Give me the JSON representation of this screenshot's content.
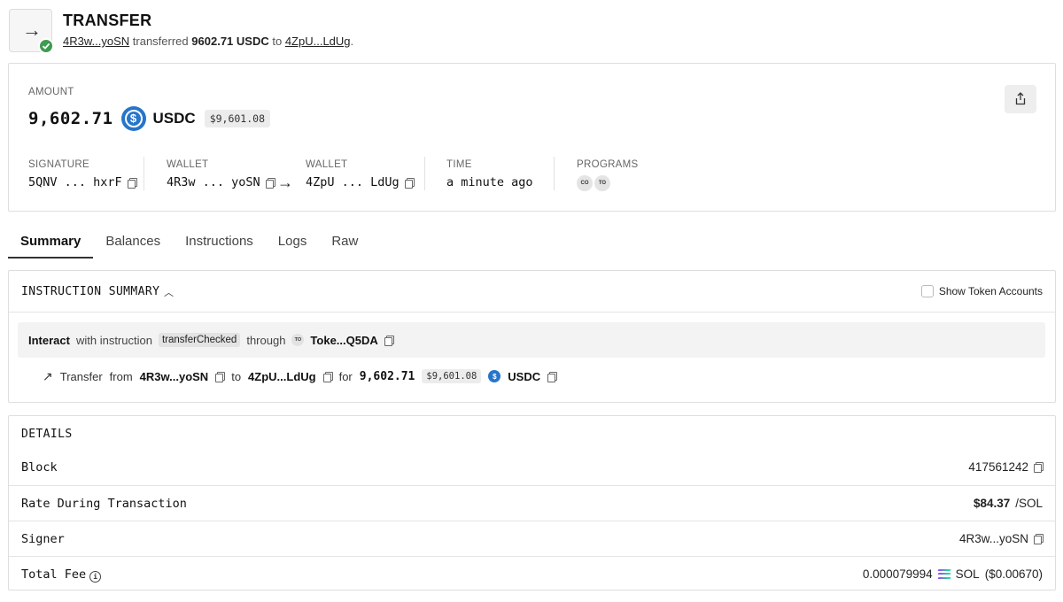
{
  "header": {
    "title": "TRANSFER",
    "from": "4R3w...yoSN",
    "verb": "transferred",
    "amount": "9602.71 USDC",
    "to_word": "to",
    "to": "4ZpU...LdUg",
    "end": "."
  },
  "amount": {
    "label": "AMOUNT",
    "value": "9,602.71",
    "token": "USDC",
    "usd": "$9,601.08"
  },
  "meta": {
    "signature_label": "SIGNATURE",
    "signature": "5QNV ... hxrF",
    "wallet_from_label": "WALLET",
    "wallet_from": "4R3w ... yoSN",
    "wallet_to_label": "WALLET",
    "wallet_to": "4ZpU ... LdUg",
    "time_label": "TIME",
    "time": "a minute ago",
    "programs_label": "PROGRAMS",
    "programs": [
      "CO",
      "TO"
    ]
  },
  "tabs": [
    "Summary",
    "Balances",
    "Instructions",
    "Logs",
    "Raw"
  ],
  "summary": {
    "title": "INSTRUCTION SUMMARY",
    "show_token_accounts": "Show Token Accounts",
    "interact": "Interact",
    "with_instruction": "with instruction",
    "instruction": "transferChecked",
    "through": "through",
    "program_badge": "TO",
    "program": "Toke...Q5DA",
    "transfer": {
      "label": "Transfer",
      "from_word": "from",
      "from": "4R3w...yoSN",
      "to_word": "to",
      "to": "4ZpU...LdUg",
      "for_word": "for",
      "amount": "9,602.71",
      "usd": "$9,601.08",
      "token": "USDC"
    }
  },
  "details": {
    "title": "DETAILS",
    "block_label": "Block",
    "block": "417561242",
    "rate_label": "Rate During Transaction",
    "rate": "$84.37",
    "rate_unit": "/SOL",
    "signer_label": "Signer",
    "signer": "4R3w...yoSN",
    "fee_label": "Total Fee",
    "fee": "0.000079994",
    "fee_token": "SOL",
    "fee_usd": "($0.00670)"
  },
  "colors": {
    "success": "#3e9b4f",
    "usdc": "#2775ca"
  }
}
